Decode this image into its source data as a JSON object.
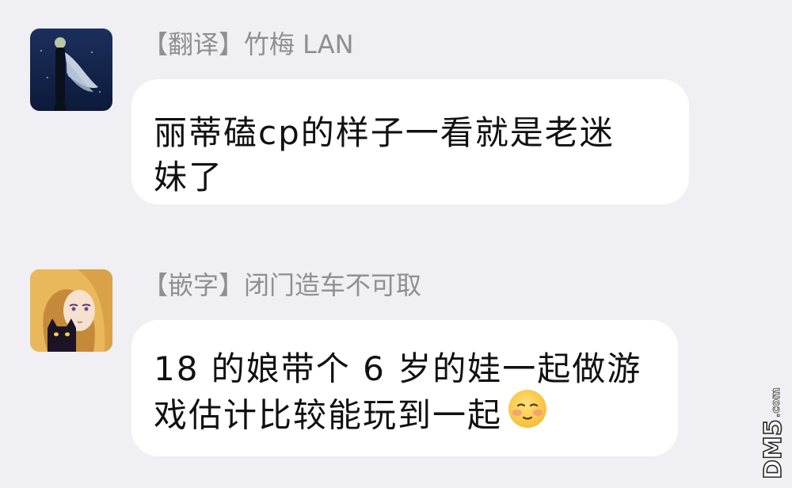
{
  "messages": [
    {
      "sender": "【翻译】竹梅 LAN",
      "lines": [
        "丽蒂磕cp的样子一看就是老迷",
        "妹了"
      ],
      "avatar_icon": "dark-figure-avatar"
    },
    {
      "sender": "【嵌字】闭门造车不可取",
      "lines": [
        "18 的娘带个 6 岁的娃一起做游",
        "戏估计比较能玩到一起"
      ],
      "avatar_icon": "blonde-girl-black-cat-avatar",
      "trailing_emoji": "blushing-face-emoji"
    }
  ],
  "watermark": {
    "text": "DM5",
    "suffix": ".com"
  },
  "colors": {
    "background": "#efeff4",
    "bubble": "#ffffff",
    "sender_text": "#8e8e93",
    "message_text": "#111111"
  }
}
